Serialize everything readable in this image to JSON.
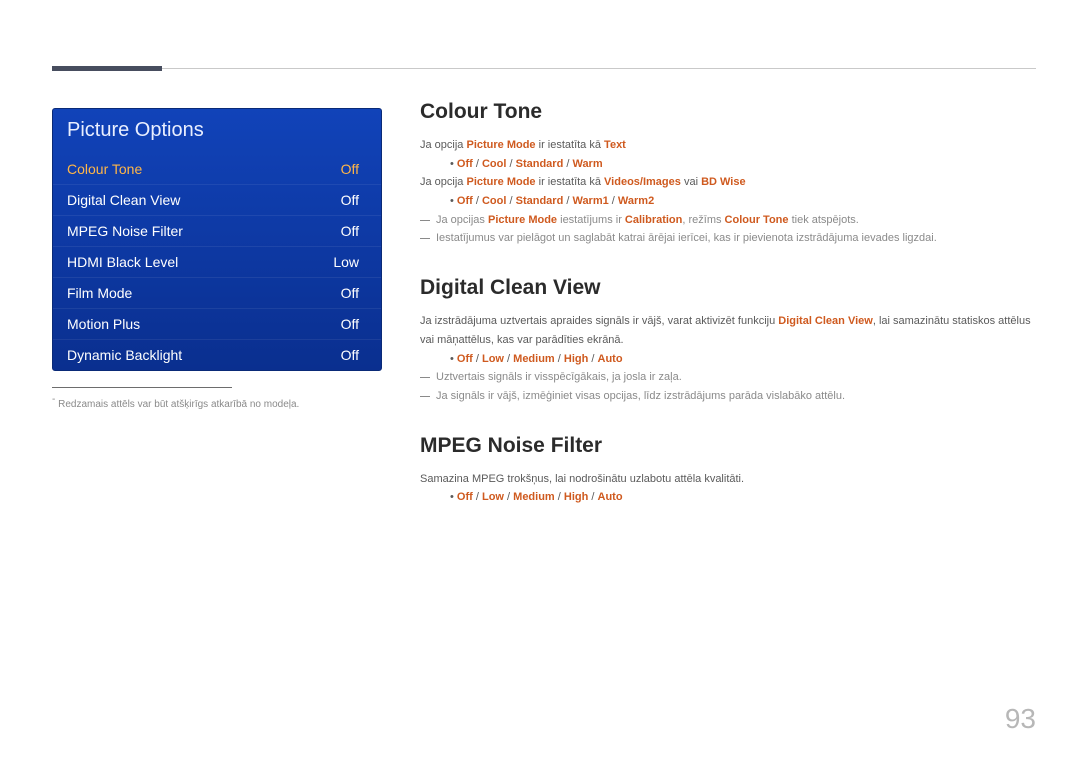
{
  "pageNumber": "93",
  "menu": {
    "title": "Picture Options",
    "items": [
      {
        "label": "Colour Tone",
        "value": "Off",
        "selected": true
      },
      {
        "label": "Digital Clean View",
        "value": "Off",
        "selected": false
      },
      {
        "label": "MPEG Noise Filter",
        "value": "Off",
        "selected": false
      },
      {
        "label": "HDMI Black Level",
        "value": "Low",
        "selected": false
      },
      {
        "label": "Film Mode",
        "value": "Off",
        "selected": false
      },
      {
        "label": "Motion Plus",
        "value": "Off",
        "selected": false
      },
      {
        "label": "Dynamic Backlight",
        "value": "Off",
        "selected": false
      }
    ]
  },
  "footnote": "Redzamais attēls var būt atšķirīgs atkarībā no modeļa.",
  "sections": {
    "colourTone": {
      "heading": "Colour Tone",
      "line1_pre": "Ja opcija ",
      "line1_hl1": "Picture Mode",
      "line1_mid": " ir iestatīta kā ",
      "line1_hl2": "Text",
      "bullet1": {
        "a": "Off",
        "b": "Cool",
        "c": "Standard",
        "d": "Warm"
      },
      "line2_pre": "Ja opcija ",
      "line2_hl1": "Picture Mode",
      "line2_mid": " ir iestatīta kā ",
      "line2_hl2": "Videos/Images",
      "line2_or": " vai ",
      "line2_hl3": "BD Wise",
      "bullet2": {
        "a": "Off",
        "b": "Cool",
        "c": "Standard",
        "d": "Warm1",
        "e": "Warm2"
      },
      "dash1_pre": "Ja opcijas ",
      "dash1_hl1": "Picture Mode",
      "dash1_mid": " iestatījums ir ",
      "dash1_hl2": "Calibration",
      "dash1_mid2": ", režīms ",
      "dash1_hl3": "Colour Tone",
      "dash1_end": " tiek atspējots.",
      "dash2": "Iestatījumus var pielāgot un saglabāt katrai ārējai ierīcei, kas ir pievienota izstrādājuma ievades ligzdai."
    },
    "digitalCleanView": {
      "heading": "Digital Clean View",
      "line1_pre": "Ja izstrādājuma uztvertais apraides signāls ir vājš, varat aktivizēt funkciju ",
      "line1_hl": "Digital Clean View",
      "line1_end": ", lai samazinātu statiskos attēlus vai māņattēlus, kas var parādīties ekrānā.",
      "bullet": {
        "a": "Off",
        "b": "Low",
        "c": "Medium",
        "d": "High",
        "e": "Auto"
      },
      "dash1": "Uztvertais signāls ir visspēcīgākais, ja josla ir zaļa.",
      "dash2": "Ja signāls ir vājš, izmēģiniet visas opcijas, līdz izstrādājums parāda vislabāko attēlu."
    },
    "mpegNoiseFilter": {
      "heading": "MPEG Noise Filter",
      "line1": "Samazina MPEG trokšņus, lai nodrošinātu uzlabotu attēla kvalitāti.",
      "bullet": {
        "a": "Off",
        "b": "Low",
        "c": "Medium",
        "d": "High",
        "e": "Auto"
      }
    }
  }
}
